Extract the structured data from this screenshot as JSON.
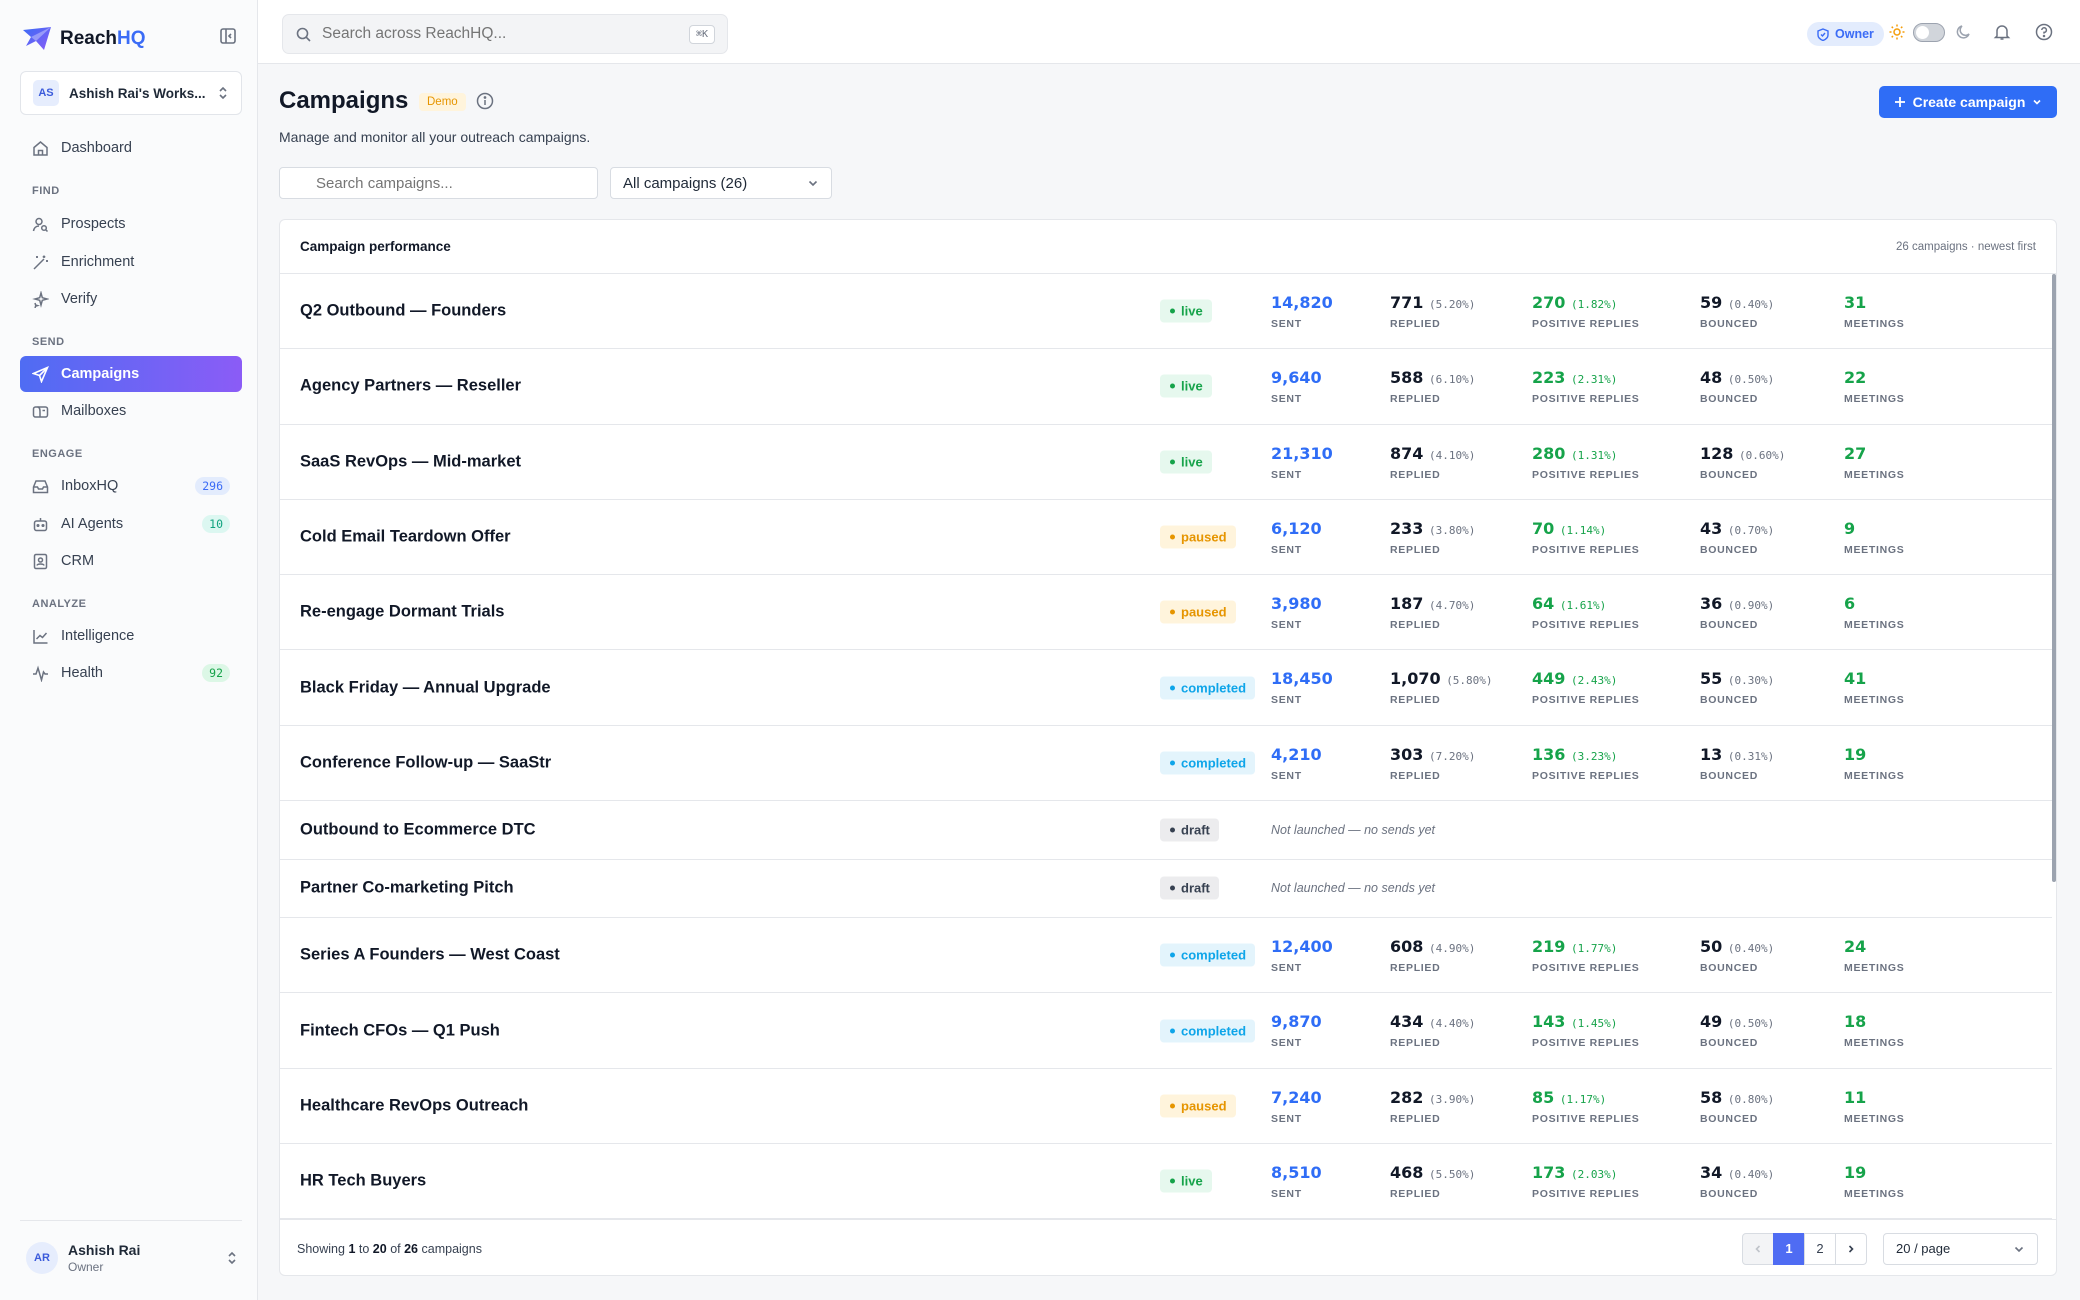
{
  "brand": {
    "name_main": "Reach",
    "name_accent": "HQ"
  },
  "workspace": {
    "initials": "AS",
    "name": "Ashish Rai's Works..."
  },
  "nav": {
    "dashboard": "Dashboard",
    "find_label": "FIND",
    "prospects": "Prospects",
    "enrichment": "Enrichment",
    "verify": "Verify",
    "send_label": "SEND",
    "campaigns": "Campaigns",
    "mailboxes": "Mailboxes",
    "engage_label": "ENGAGE",
    "inboxhq": "InboxHQ",
    "inboxhq_count": "296",
    "ai_agents": "AI Agents",
    "ai_agents_count": "10",
    "crm": "CRM",
    "analyze_label": "ANALYZE",
    "intelligence": "Intelligence",
    "health": "Health",
    "health_count": "92"
  },
  "user": {
    "initials": "AR",
    "name": "Ashish Rai",
    "role": "Owner"
  },
  "topbar": {
    "search_placeholder": "Search across ReachHQ...",
    "shortcut": "⌘K",
    "role_badge": "Owner"
  },
  "page": {
    "title": "Campaigns",
    "demo_badge": "Demo",
    "subtitle": "Manage and monitor all your outreach campaigns.",
    "create_button": "Create campaign",
    "search_placeholder": "Search campaigns...",
    "filter_value": "All campaigns (26)"
  },
  "card": {
    "title": "Campaign performance",
    "meta": "26 campaigns · newest first",
    "captions": {
      "sent": "SENT",
      "replied": "REPLIED",
      "positive": "POSITIVE REPLIES",
      "bounced": "BOUNCED",
      "meetings": "MEETINGS"
    },
    "no_sends": "Not launched — no sends yet"
  },
  "campaigns": [
    {
      "name": "Q2 Outbound — Founders",
      "status": "live",
      "sent": "14,820",
      "replied": "771",
      "replied_pct": "(5.20%)",
      "positive": "270",
      "positive_pct": "(1.82%)",
      "bounced": "59",
      "bounced_pct": "(0.40%)",
      "meetings": "31"
    },
    {
      "name": "Agency Partners — Reseller",
      "status": "live",
      "sent": "9,640",
      "replied": "588",
      "replied_pct": "(6.10%)",
      "positive": "223",
      "positive_pct": "(2.31%)",
      "bounced": "48",
      "bounced_pct": "(0.50%)",
      "meetings": "22"
    },
    {
      "name": "SaaS RevOps — Mid-market",
      "status": "live",
      "sent": "21,310",
      "replied": "874",
      "replied_pct": "(4.10%)",
      "positive": "280",
      "positive_pct": "(1.31%)",
      "bounced": "128",
      "bounced_pct": "(0.60%)",
      "meetings": "27"
    },
    {
      "name": "Cold Email Teardown Offer",
      "status": "paused",
      "sent": "6,120",
      "replied": "233",
      "replied_pct": "(3.80%)",
      "positive": "70",
      "positive_pct": "(1.14%)",
      "bounced": "43",
      "bounced_pct": "(0.70%)",
      "meetings": "9"
    },
    {
      "name": "Re-engage Dormant Trials",
      "status": "paused",
      "sent": "3,980",
      "replied": "187",
      "replied_pct": "(4.70%)",
      "positive": "64",
      "positive_pct": "(1.61%)",
      "bounced": "36",
      "bounced_pct": "(0.90%)",
      "meetings": "6"
    },
    {
      "name": "Black Friday — Annual Upgrade",
      "status": "completed",
      "sent": "18,450",
      "replied": "1,070",
      "replied_pct": "(5.80%)",
      "positive": "449",
      "positive_pct": "(2.43%)",
      "bounced": "55",
      "bounced_pct": "(0.30%)",
      "meetings": "41"
    },
    {
      "name": "Conference Follow-up — SaaStr",
      "status": "completed",
      "sent": "4,210",
      "replied": "303",
      "replied_pct": "(7.20%)",
      "positive": "136",
      "positive_pct": "(3.23%)",
      "bounced": "13",
      "bounced_pct": "(0.31%)",
      "meetings": "19"
    },
    {
      "name": "Outbound to Ecommerce DTC",
      "status": "draft"
    },
    {
      "name": "Partner Co-marketing Pitch",
      "status": "draft"
    },
    {
      "name": "Series A Founders — West Coast",
      "status": "completed",
      "sent": "12,400",
      "replied": "608",
      "replied_pct": "(4.90%)",
      "positive": "219",
      "positive_pct": "(1.77%)",
      "bounced": "50",
      "bounced_pct": "(0.40%)",
      "meetings": "24"
    },
    {
      "name": "Fintech CFOs — Q1 Push",
      "status": "completed",
      "sent": "9,870",
      "replied": "434",
      "replied_pct": "(4.40%)",
      "positive": "143",
      "positive_pct": "(1.45%)",
      "bounced": "49",
      "bounced_pct": "(0.50%)",
      "meetings": "18"
    },
    {
      "name": "Healthcare RevOps Outreach",
      "status": "paused",
      "sent": "7,240",
      "replied": "282",
      "replied_pct": "(3.90%)",
      "positive": "85",
      "positive_pct": "(1.17%)",
      "bounced": "58",
      "bounced_pct": "(0.80%)",
      "meetings": "11"
    },
    {
      "name": "HR Tech Buyers",
      "status": "live",
      "sent": "8,510",
      "replied": "468",
      "replied_pct": "(5.50%)",
      "positive": "173",
      "positive_pct": "(2.03%)",
      "bounced": "34",
      "bounced_pct": "(0.40%)",
      "meetings": "19"
    }
  ],
  "footer": {
    "showing_prefix": "Showing",
    "from": "1",
    "to_word": "to",
    "to": "20",
    "of_word": "of",
    "total": "26",
    "suffix": "campaigns",
    "pages": [
      "1",
      "2"
    ],
    "per_page": "20 / page"
  },
  "colors": {
    "accent": "#2f6df6",
    "live": "#16a34a",
    "paused": "#e69500",
    "completed": "#0ea5e9",
    "draft": "#374151"
  }
}
